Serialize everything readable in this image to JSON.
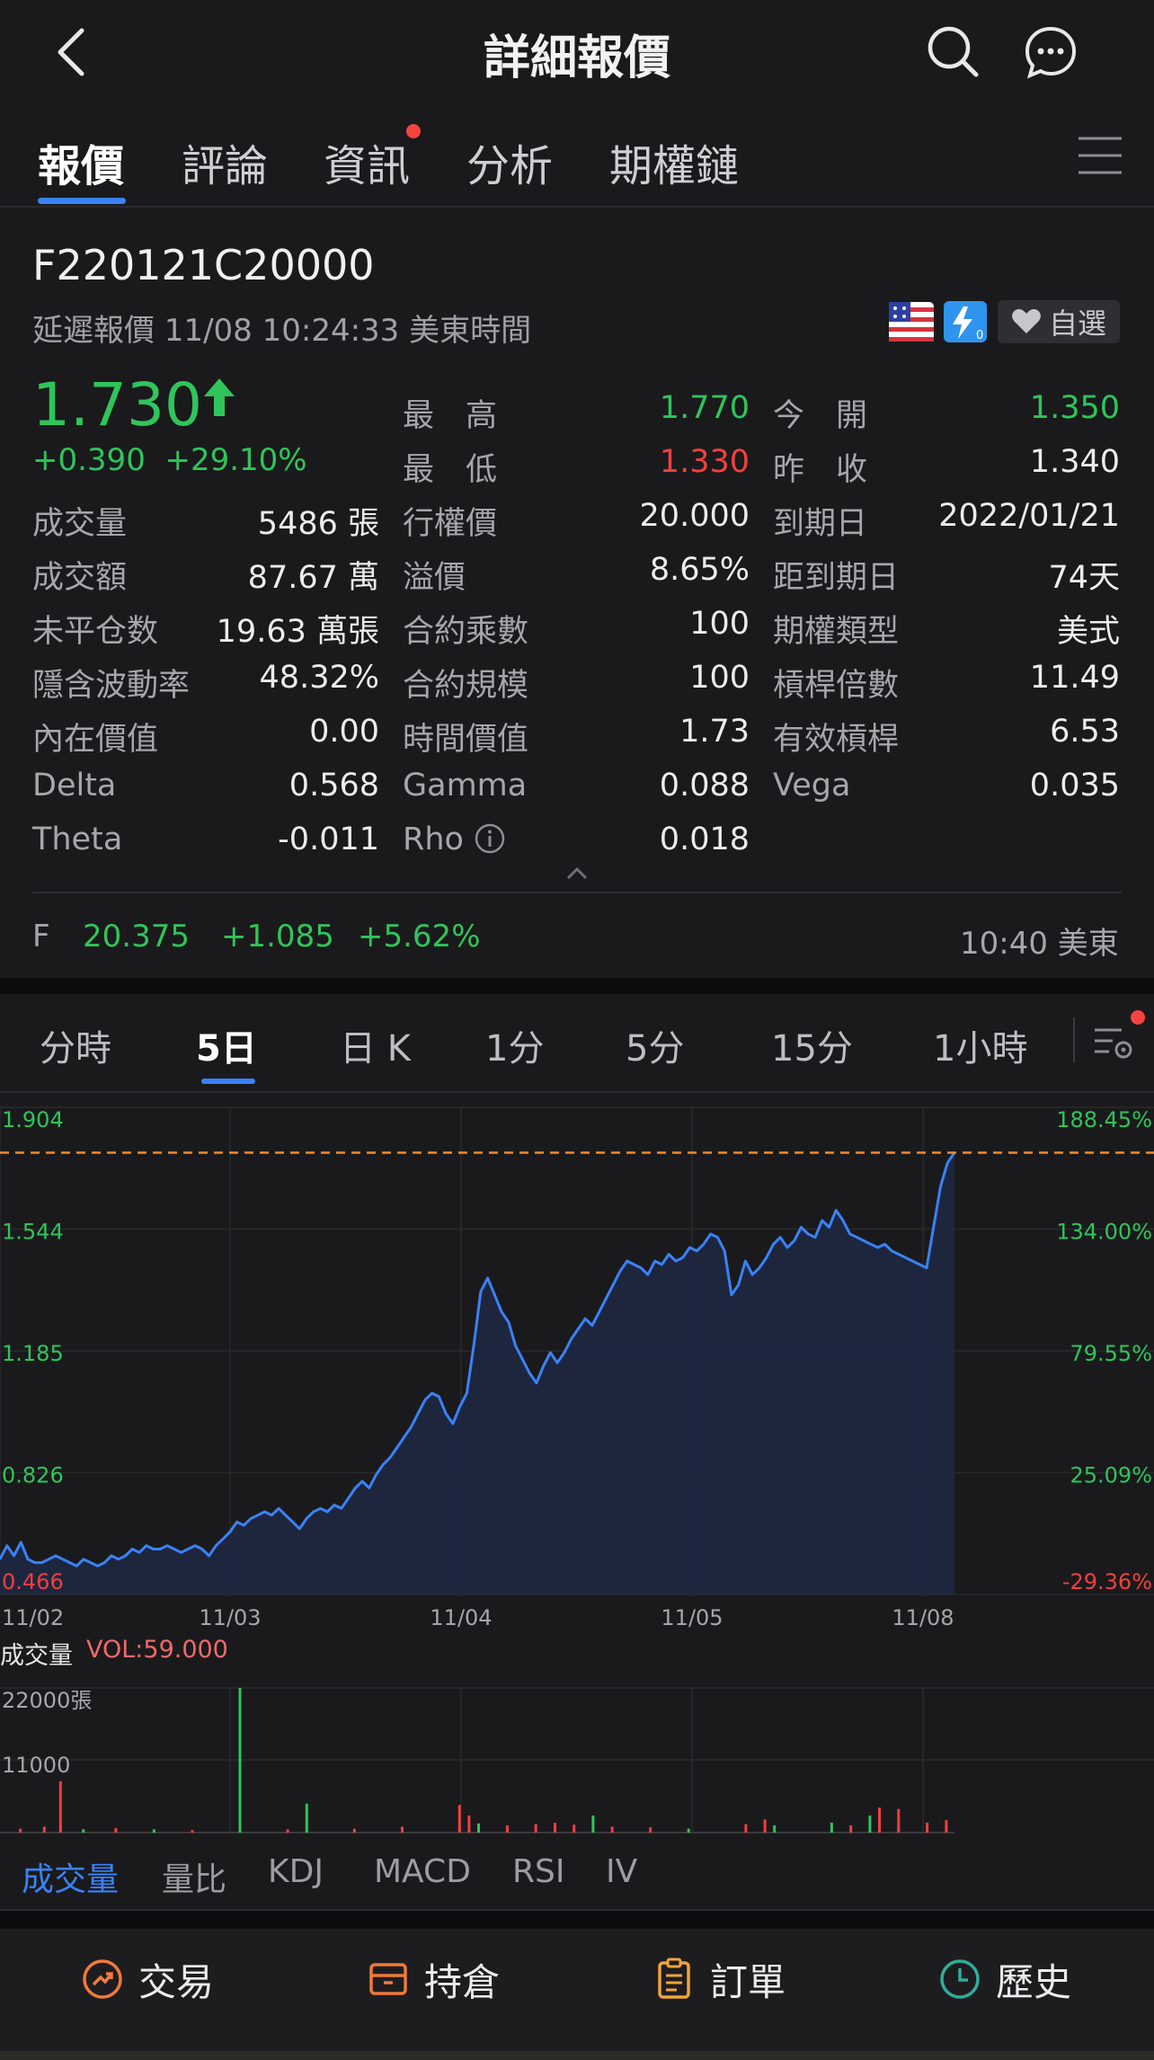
{
  "header": {
    "title": "詳細報價"
  },
  "tabs": [
    {
      "label": "報價",
      "active": true
    },
    {
      "label": "評論",
      "active": false
    },
    {
      "label": "資訊",
      "active": false,
      "badge_dot": true
    },
    {
      "label": "分析",
      "active": false
    },
    {
      "label": "期權鏈",
      "active": false
    }
  ],
  "quote": {
    "symbol": "F220121C20000",
    "delay_text": "延遲報價 11/08 10:24:33 美東時間",
    "watchlist_label": "自選",
    "last_price": "1.730",
    "change": "+0.390",
    "change_pct": "+29.10%",
    "col2": [
      {
        "label": "最　高",
        "value": "1.770",
        "color": "green"
      },
      {
        "label": "最　低",
        "value": "1.330",
        "color": "red"
      },
      {
        "label": "行權價",
        "value": "20.000",
        "color": "white"
      },
      {
        "label": "溢價",
        "value": "8.65%",
        "color": "white"
      },
      {
        "label": "合約乘數",
        "value": "100",
        "color": "white"
      },
      {
        "label": "合約規模",
        "value": "100",
        "color": "white"
      },
      {
        "label": "時間價值",
        "value": "1.73",
        "color": "white"
      },
      {
        "label": "Gamma",
        "value": "0.088",
        "color": "white"
      },
      {
        "label": "Rho",
        "value": "0.018",
        "color": "white"
      }
    ],
    "col1": [
      {
        "label": "成交量",
        "value": "5486 張"
      },
      {
        "label": "成交額",
        "value": "87.67 萬"
      },
      {
        "label": "未平仓数",
        "value": "19.63 萬張"
      },
      {
        "label": "隱含波動率",
        "value": "48.32%"
      },
      {
        "label": "內在價值",
        "value": "0.00"
      },
      {
        "label": "Delta",
        "value": "0.568"
      },
      {
        "label": "Theta",
        "value": "-0.011"
      }
    ],
    "col3": [
      {
        "label": "今　開",
        "value": "1.350",
        "color": "green"
      },
      {
        "label": "昨　收",
        "value": "1.340",
        "color": "white"
      },
      {
        "label": "到期日",
        "value": "2022/01/21",
        "color": "white"
      },
      {
        "label": "距到期日",
        "value": "74天",
        "color": "white"
      },
      {
        "label": "期權類型",
        "value": "美式",
        "color": "white"
      },
      {
        "label": "槓桿倍數",
        "value": "11.49",
        "color": "white"
      },
      {
        "label": "有效槓桿",
        "value": "6.53",
        "color": "white"
      },
      {
        "label": "Vega",
        "value": "0.035",
        "color": "white"
      }
    ]
  },
  "underlying": {
    "symbol": "F",
    "price": "20.375",
    "change": "+1.085",
    "change_pct": "+5.62%",
    "time": "10:40 美東"
  },
  "period_tabs": [
    {
      "label": "分時",
      "active": false
    },
    {
      "label": "5日",
      "active": true
    },
    {
      "label": "日 K",
      "active": false
    },
    {
      "label": "1分",
      "active": false
    },
    {
      "label": "5分",
      "active": false
    },
    {
      "label": "15分",
      "active": false
    },
    {
      "label": "1小時",
      "active": false
    }
  ],
  "chart_data": {
    "type": "area",
    "y_ticks": [
      "1.904",
      "1.544",
      "1.185",
      "0.826",
      "0.466"
    ],
    "y_pct_ticks": [
      "188.45%",
      "134.00%",
      "79.55%",
      "25.09%",
      "-29.36%"
    ],
    "ylim": [
      0.466,
      1.904
    ],
    "reference_price": 1.77,
    "x_labels": [
      "11/02",
      "11/03",
      "11/04",
      "11/05",
      "11/08"
    ],
    "series": [
      {
        "values": [
          0.57,
          0.61,
          0.58,
          0.62,
          0.57,
          0.56,
          0.56,
          0.57,
          0.58,
          0.57,
          0.56,
          0.55,
          0.57,
          0.56,
          0.55,
          0.56,
          0.58,
          0.57,
          0.58,
          0.6,
          0.59,
          0.61,
          0.6,
          0.6,
          0.61,
          0.6,
          0.59,
          0.6,
          0.61,
          0.6,
          0.58,
          0.61,
          0.63,
          0.65,
          0.68,
          0.67,
          0.69,
          0.7,
          0.71,
          0.7,
          0.72,
          0.7,
          0.68,
          0.66,
          0.69,
          0.71,
          0.72,
          0.71,
          0.73,
          0.72,
          0.75,
          0.78,
          0.8,
          0.78,
          0.82,
          0.85,
          0.87,
          0.9,
          0.93,
          0.96,
          1.0,
          1.04,
          1.06,
          1.05,
          1.0,
          0.97,
          1.02,
          1.06,
          1.2,
          1.36,
          1.4,
          1.35,
          1.3,
          1.27,
          1.2,
          1.16,
          1.12,
          1.09,
          1.14,
          1.18,
          1.15,
          1.18,
          1.22,
          1.25,
          1.28,
          1.26,
          1.3,
          1.34,
          1.38,
          1.42,
          1.45,
          1.44,
          1.43,
          1.41,
          1.45,
          1.44,
          1.47,
          1.45,
          1.46,
          1.49,
          1.48,
          1.5,
          1.53,
          1.52,
          1.48,
          1.35,
          1.38,
          1.45,
          1.41,
          1.43,
          1.46,
          1.5,
          1.52,
          1.49,
          1.51,
          1.55,
          1.53,
          1.52,
          1.57,
          1.55,
          1.6,
          1.57,
          1.53,
          1.52,
          1.51,
          1.5,
          1.49,
          1.5,
          1.48,
          1.47,
          1.46,
          1.45,
          1.44,
          1.43,
          1.55,
          1.67,
          1.74,
          1.77
        ]
      }
    ]
  },
  "volume": {
    "title": "成交量",
    "vol_text": "VOL:59.000",
    "y_ticks": [
      "22000張",
      "11000"
    ],
    "max": 22000,
    "bars": [
      {
        "x": 0.02,
        "v": 600,
        "c": "red"
      },
      {
        "x": 0.045,
        "v": 900,
        "c": "red"
      },
      {
        "x": 0.062,
        "v": 7800,
        "c": "red"
      },
      {
        "x": 0.086,
        "v": 500,
        "c": "green"
      },
      {
        "x": 0.12,
        "v": 700,
        "c": "red"
      },
      {
        "x": 0.16,
        "v": 500,
        "c": "green"
      },
      {
        "x": 0.2,
        "v": 400,
        "c": "red"
      },
      {
        "x": 0.25,
        "v": 22000,
        "c": "green"
      },
      {
        "x": 0.3,
        "v": 500,
        "c": "red"
      },
      {
        "x": 0.32,
        "v": 4400,
        "c": "green"
      },
      {
        "x": 0.37,
        "v": 600,
        "c": "red"
      },
      {
        "x": 0.42,
        "v": 900,
        "c": "red"
      },
      {
        "x": 0.48,
        "v": 4200,
        "c": "red"
      },
      {
        "x": 0.49,
        "v": 2600,
        "c": "red"
      },
      {
        "x": 0.5,
        "v": 1400,
        "c": "green"
      },
      {
        "x": 0.53,
        "v": 1100,
        "c": "red"
      },
      {
        "x": 0.56,
        "v": 1300,
        "c": "red"
      },
      {
        "x": 0.58,
        "v": 1500,
        "c": "red"
      },
      {
        "x": 0.6,
        "v": 1200,
        "c": "red"
      },
      {
        "x": 0.62,
        "v": 2600,
        "c": "green"
      },
      {
        "x": 0.64,
        "v": 900,
        "c": "red"
      },
      {
        "x": 0.68,
        "v": 800,
        "c": "red"
      },
      {
        "x": 0.72,
        "v": 600,
        "c": "green"
      },
      {
        "x": 0.78,
        "v": 1300,
        "c": "red"
      },
      {
        "x": 0.8,
        "v": 2000,
        "c": "red"
      },
      {
        "x": 0.81,
        "v": 1100,
        "c": "green"
      },
      {
        "x": 0.87,
        "v": 1500,
        "c": "green"
      },
      {
        "x": 0.89,
        "v": 1100,
        "c": "red"
      },
      {
        "x": 0.91,
        "v": 2600,
        "c": "green"
      },
      {
        "x": 0.92,
        "v": 3800,
        "c": "red"
      },
      {
        "x": 0.94,
        "v": 3600,
        "c": "red"
      },
      {
        "x": 0.97,
        "v": 1500,
        "c": "red"
      },
      {
        "x": 0.99,
        "v": 1900,
        "c": "red"
      }
    ]
  },
  "indicator_tabs": [
    {
      "label": "成交量",
      "active": true
    },
    {
      "label": "量比",
      "active": false
    },
    {
      "label": "KDJ",
      "active": false
    },
    {
      "label": "MACD",
      "active": false
    },
    {
      "label": "RSI",
      "active": false
    },
    {
      "label": "IV",
      "active": false
    }
  ],
  "bottom_bar": [
    {
      "label": "交易",
      "icon": "trade-icon",
      "color": "#f07a3a"
    },
    {
      "label": "持倉",
      "icon": "position-icon",
      "color": "#f07a3a"
    },
    {
      "label": "訂單",
      "icon": "order-icon",
      "color": "#f2a33a"
    },
    {
      "label": "歷史",
      "icon": "history-icon",
      "color": "#2fae9a"
    }
  ],
  "colors": {
    "accent": "#3a82f7",
    "up": "#2fc55a",
    "down": "#f0403f",
    "line": "#3a82f7",
    "reference": "#f28a2e"
  }
}
